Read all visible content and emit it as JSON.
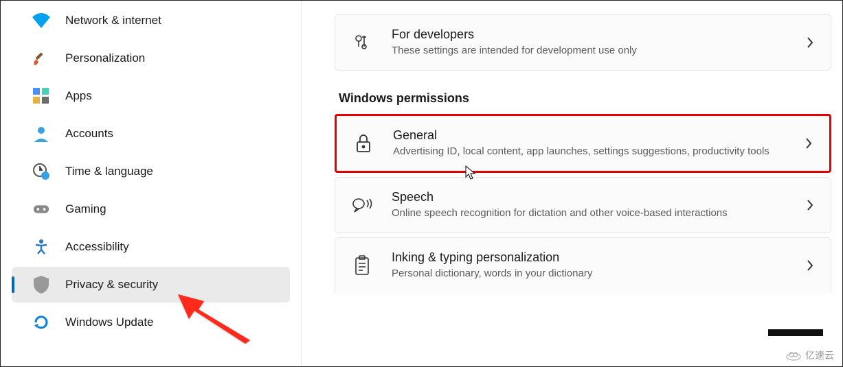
{
  "sidebar": {
    "items": [
      {
        "label": "Network & internet"
      },
      {
        "label": "Personalization"
      },
      {
        "label": "Apps"
      },
      {
        "label": "Accounts"
      },
      {
        "label": "Time & language"
      },
      {
        "label": "Gaming"
      },
      {
        "label": "Accessibility"
      },
      {
        "label": "Privacy & security"
      },
      {
        "label": "Windows Update"
      }
    ],
    "selected_index": 7
  },
  "main": {
    "section1_title": "Windows permissions",
    "cards": [
      {
        "title": "For developers",
        "desc": "These settings are intended for development use only"
      },
      {
        "title": "General",
        "desc": "Advertising ID, local content, app launches, settings suggestions, productivity tools"
      },
      {
        "title": "Speech",
        "desc": "Online speech recognition for dictation and other voice-based interactions"
      },
      {
        "title": "Inking & typing personalization",
        "desc": "Personal dictionary, words in your dictionary"
      }
    ],
    "highlight_index": 1
  },
  "watermark": "亿速云"
}
